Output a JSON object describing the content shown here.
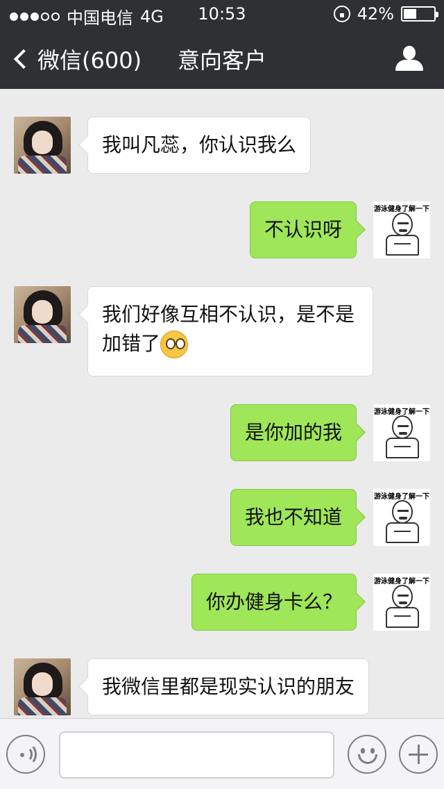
{
  "status": {
    "signal_dots": 5,
    "signal_filled": 3,
    "carrier": "中国电信",
    "network": "4G",
    "time": "10:53",
    "battery": "42%",
    "battery_level": 0.42
  },
  "nav": {
    "back_label": "微信(600)",
    "title": "意向客户"
  },
  "messages": [
    {
      "side": "in",
      "text": "我叫凡蕊，你认识我么"
    },
    {
      "side": "out",
      "text": "不认识呀"
    },
    {
      "side": "in",
      "text": "我们好像互相不认识，是不是加错了",
      "emoji": "flushed-emoji"
    },
    {
      "side": "out",
      "text": "是你加的我"
    },
    {
      "side": "out",
      "text": "我也不知道"
    },
    {
      "side": "out",
      "text": "你办健身卡么？"
    },
    {
      "side": "in",
      "text": "我微信里都是现实认识的朋友"
    }
  ],
  "meme_caption": "游泳健身了解一下",
  "input": {
    "placeholder": ""
  },
  "icons": {
    "voice": "voice-icon",
    "emoji": "emoji-face-icon",
    "plus": "plus-icon",
    "contact": "person-icon"
  }
}
